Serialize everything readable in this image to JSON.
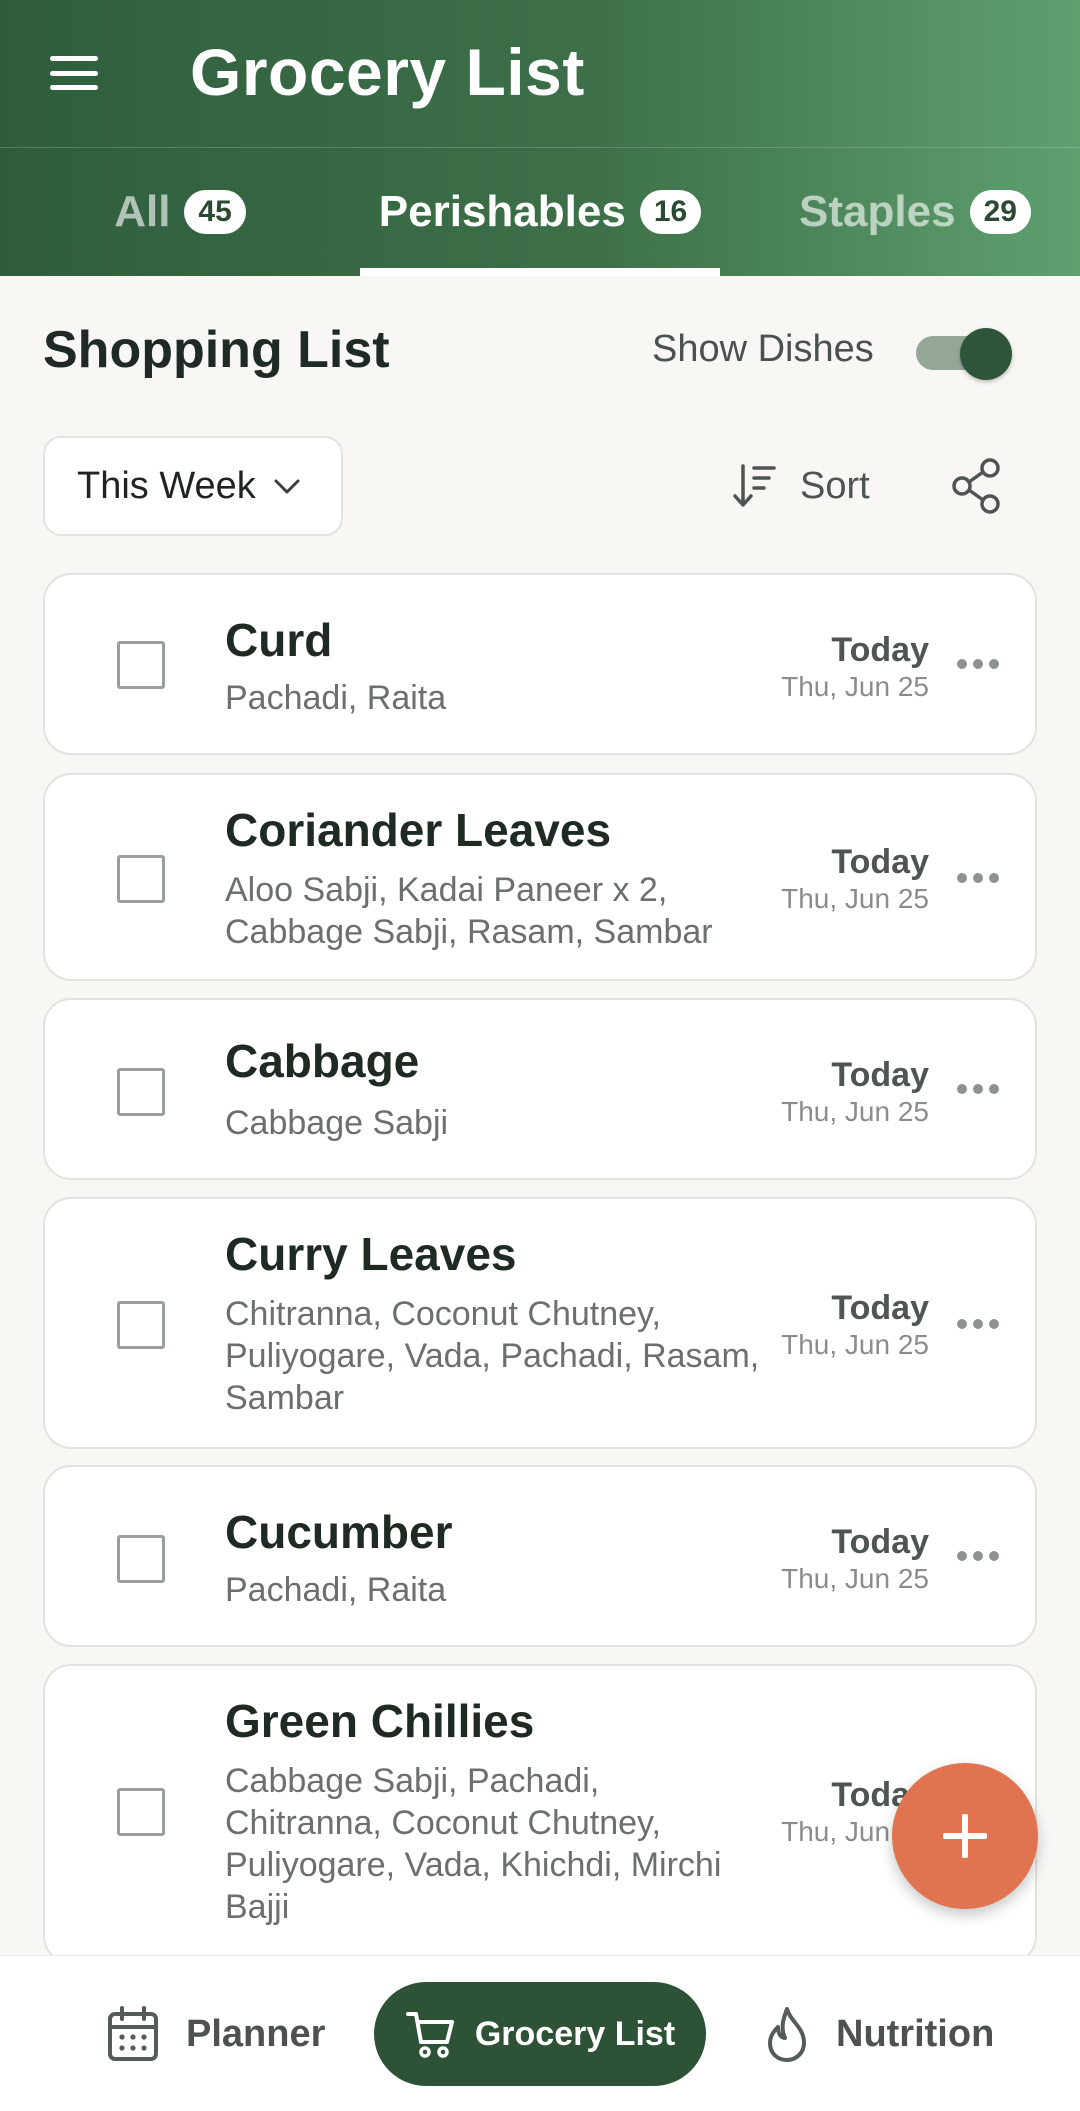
{
  "header": {
    "title": "Grocery List",
    "menu_icon": "hamburger-menu-icon"
  },
  "tabs": [
    {
      "label": "All",
      "count": "45"
    },
    {
      "label": "Perishables",
      "count": "16"
    },
    {
      "label": "Staples",
      "count": "29"
    }
  ],
  "active_tab": "Perishables",
  "section": {
    "title": "Shopping List",
    "show_dishes_label": "Show Dishes",
    "show_dishes_on": true
  },
  "filters": {
    "week": "This Week",
    "sort_label": "Sort"
  },
  "items": [
    {
      "name": "Curd",
      "dishes": "Pachadi, Raita",
      "day": "Today",
      "date": "Thu, Jun 25"
    },
    {
      "name": "Coriander Leaves",
      "dishes": "Aloo Sabji, Kadai Paneer x 2, Cabbage Sabji, Rasam, Sambar",
      "day": "Today",
      "date": "Thu, Jun 25"
    },
    {
      "name": "Cabbage",
      "dishes": "Cabbage Sabji",
      "day": "Today",
      "date": "Thu, Jun 25"
    },
    {
      "name": "Curry Leaves",
      "dishes": "Chitranna, Coconut Chutney, Puliyogare, Vada, Pachadi, Rasam, Sambar",
      "day": "Today",
      "date": "Thu, Jun 25"
    },
    {
      "name": "Cucumber",
      "dishes": "Pachadi, Raita",
      "day": "Today",
      "date": "Thu, Jun 25"
    },
    {
      "name": "Green Chillies",
      "dishes": "Cabbage Sabji, Pachadi, Chitranna, Coconut Chutney, Puliyogare, Vada, Khichdi, Mirchi Bajji",
      "day": "Today",
      "date": "Thu, Jun 25"
    }
  ],
  "bottom_nav": {
    "planner": "Planner",
    "grocery": "Grocery List",
    "nutrition": "Nutrition"
  },
  "colors": {
    "primary": "#2d5236",
    "accent": "#e07350"
  }
}
